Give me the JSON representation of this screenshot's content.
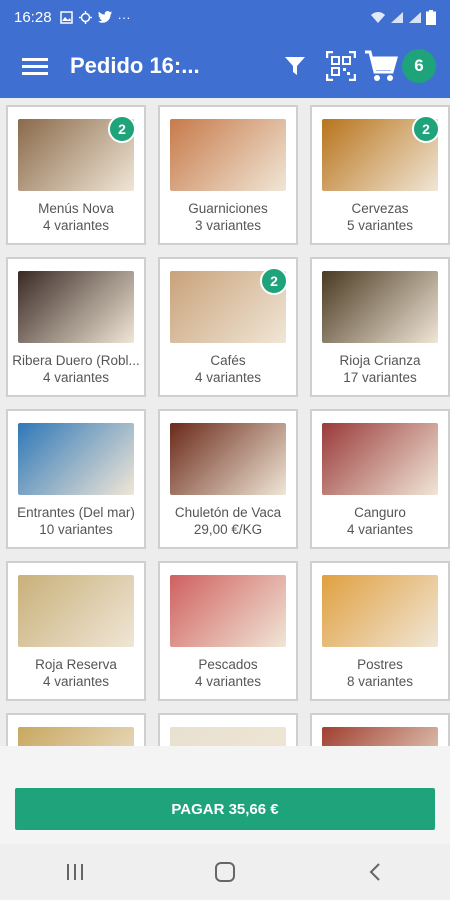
{
  "status_bar": {
    "time": "16:28",
    "dots": "···"
  },
  "app_bar": {
    "title": "Pedido 16:...",
    "cart_count": "6"
  },
  "colors": {
    "primary": "#3f6fd1",
    "accent": "#1ea37a"
  },
  "products": [
    {
      "name": "Menús Nova",
      "sub": "4 variantes",
      "badge": "2",
      "thumb_color": "#8a6a4a"
    },
    {
      "name": "Guarniciones",
      "sub": "3 variantes",
      "badge": "",
      "thumb_color": "#c77a4a"
    },
    {
      "name": "Cervezas",
      "sub": "5 variantes",
      "badge": "2",
      "thumb_color": "#b8741c"
    },
    {
      "name": "Ribera Duero (Robl...",
      "sub": "4 variantes",
      "badge": "",
      "thumb_color": "#3a2a25"
    },
    {
      "name": "Cafés",
      "sub": "4 variantes",
      "badge": "2",
      "thumb_color": "#c9a27a"
    },
    {
      "name": "Rioja Crianza",
      "sub": "17 variantes",
      "badge": "",
      "thumb_color": "#4a3a22"
    },
    {
      "name": "Entrantes (Del mar)",
      "sub": "10 variantes",
      "badge": "",
      "thumb_color": "#2f78b8"
    },
    {
      "name": "Chuletón de Vaca",
      "sub": "29,00 €/KG",
      "badge": "",
      "thumb_color": "#6a2a1a"
    },
    {
      "name": "Canguro",
      "sub": "4 variantes",
      "badge": "",
      "thumb_color": "#9a3a3a"
    },
    {
      "name": "Roja Reserva",
      "sub": "4 variantes",
      "badge": "",
      "thumb_color": "#c9b07a"
    },
    {
      "name": "Pescados",
      "sub": "4 variantes",
      "badge": "",
      "thumb_color": "#d06060"
    },
    {
      "name": "Postres",
      "sub": "8 variantes",
      "badge": "",
      "thumb_color": "#e0a040"
    },
    {
      "name": "",
      "sub": "",
      "badge": "",
      "thumb_color": "#c8a860"
    },
    {
      "name": "",
      "sub": "",
      "badge": "",
      "thumb_color": "#e8e0d0"
    },
    {
      "name": "",
      "sub": "",
      "badge": "",
      "thumb_color": "#a04030"
    }
  ],
  "pay_button": {
    "label": "PAGAR 35,66 €"
  }
}
